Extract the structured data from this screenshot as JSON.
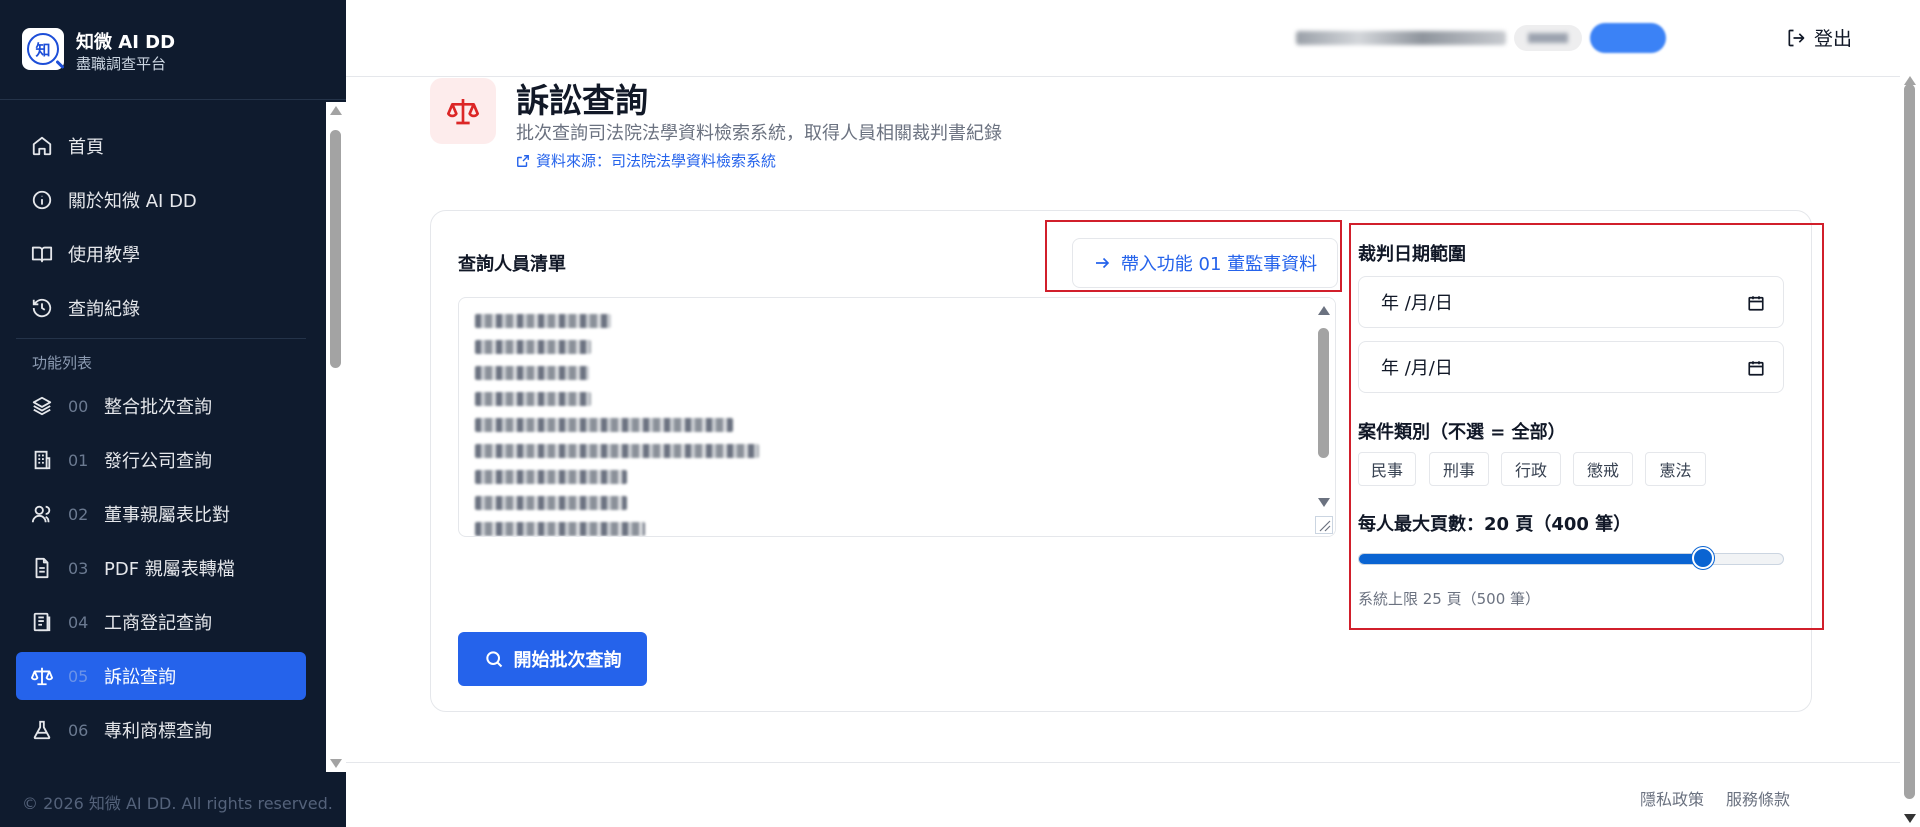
{
  "sidebar": {
    "brand_title": "知微 AI DD",
    "brand_subtitle": "盡職調查平台",
    "logo_char": "知",
    "top_items": [
      {
        "label": "首頁",
        "icon": "home-icon"
      },
      {
        "label": "關於知微 AI DD",
        "icon": "info-icon"
      },
      {
        "label": "使用教學",
        "icon": "book-icon"
      },
      {
        "label": "查詢紀錄",
        "icon": "history-icon"
      }
    ],
    "section_label": "功能列表",
    "feature_items": [
      {
        "num": "00",
        "label": "整合批次查詢",
        "icon": "layers-icon"
      },
      {
        "num": "01",
        "label": "發行公司查詢",
        "icon": "building-icon"
      },
      {
        "num": "02",
        "label": "董事親屬表比對",
        "icon": "users-icon"
      },
      {
        "num": "03",
        "label": "PDF 親屬表轉檔",
        "icon": "file-icon"
      },
      {
        "num": "04",
        "label": "工商登記查詢",
        "icon": "registry-icon"
      },
      {
        "num": "05",
        "label": "訴訟查詢",
        "icon": "scale-icon",
        "active": true
      },
      {
        "num": "06",
        "label": "專利商標查詢",
        "icon": "flask-icon"
      }
    ],
    "copyright": "© 2026 知微 AI DD. All rights reserved."
  },
  "topbar": {
    "logout_label": "登出"
  },
  "page": {
    "title": "訴訟查詢",
    "description": "批次查詢司法院法學資料檢索系統，取得人員相關裁判書紀錄",
    "source_link": "資料來源：司法院法學資料檢索系統"
  },
  "form": {
    "list_label": "查詢人員清單",
    "import_button": "帶入功能 01 董監事資料",
    "start_button": "開始批次查詢",
    "date_range_label": "裁判日期範圍",
    "date_from_placeholder": "年 /月/日",
    "date_to_placeholder": "年 /月/日",
    "case_type_label": "案件類別（不選 = 全部）",
    "case_types": [
      "民事",
      "刑事",
      "行政",
      "懲戒",
      "憲法"
    ],
    "max_pages_label": "每人最大頁數：20 頁（400 筆）",
    "max_pages_value": 20,
    "max_pages_limit": 25,
    "slider_hint": "系統上限 25 頁（500 筆）"
  },
  "footer": {
    "privacy": "隱私政策",
    "terms": "服務條款"
  },
  "colors": {
    "sidebar_bg": "#0f1b2e",
    "accent": "#2563eb",
    "highlight_box": "#d11f2b",
    "page_icon": "#dc2626"
  }
}
